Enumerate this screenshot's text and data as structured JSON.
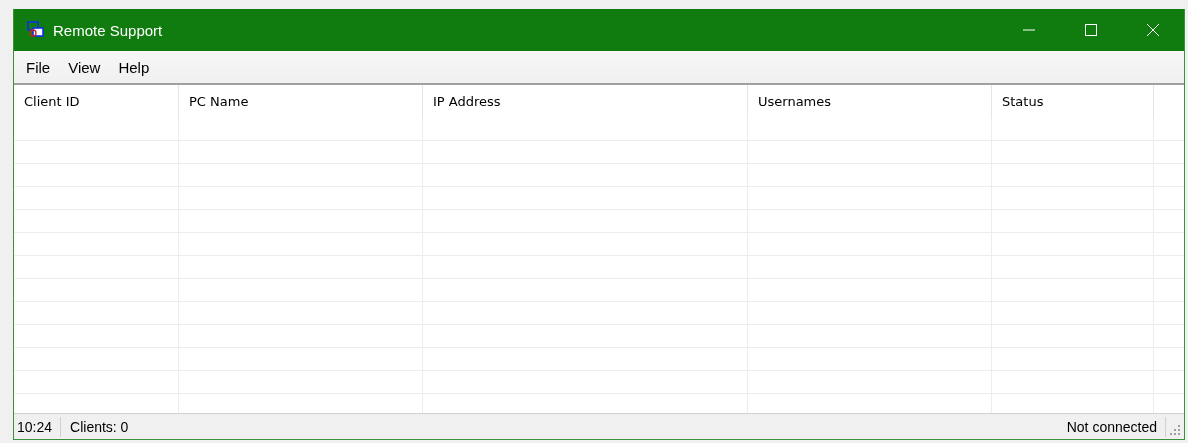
{
  "window": {
    "title": "Remote Support"
  },
  "menu": [
    "File",
    "View",
    "Help"
  ],
  "table": {
    "columns": [
      "Client ID",
      "PC Name",
      "IP Address",
      "Usernames",
      "Status"
    ]
  },
  "status_bar": {
    "time": "10:24",
    "clients": "Clients: 0",
    "connection": "Not connected"
  }
}
